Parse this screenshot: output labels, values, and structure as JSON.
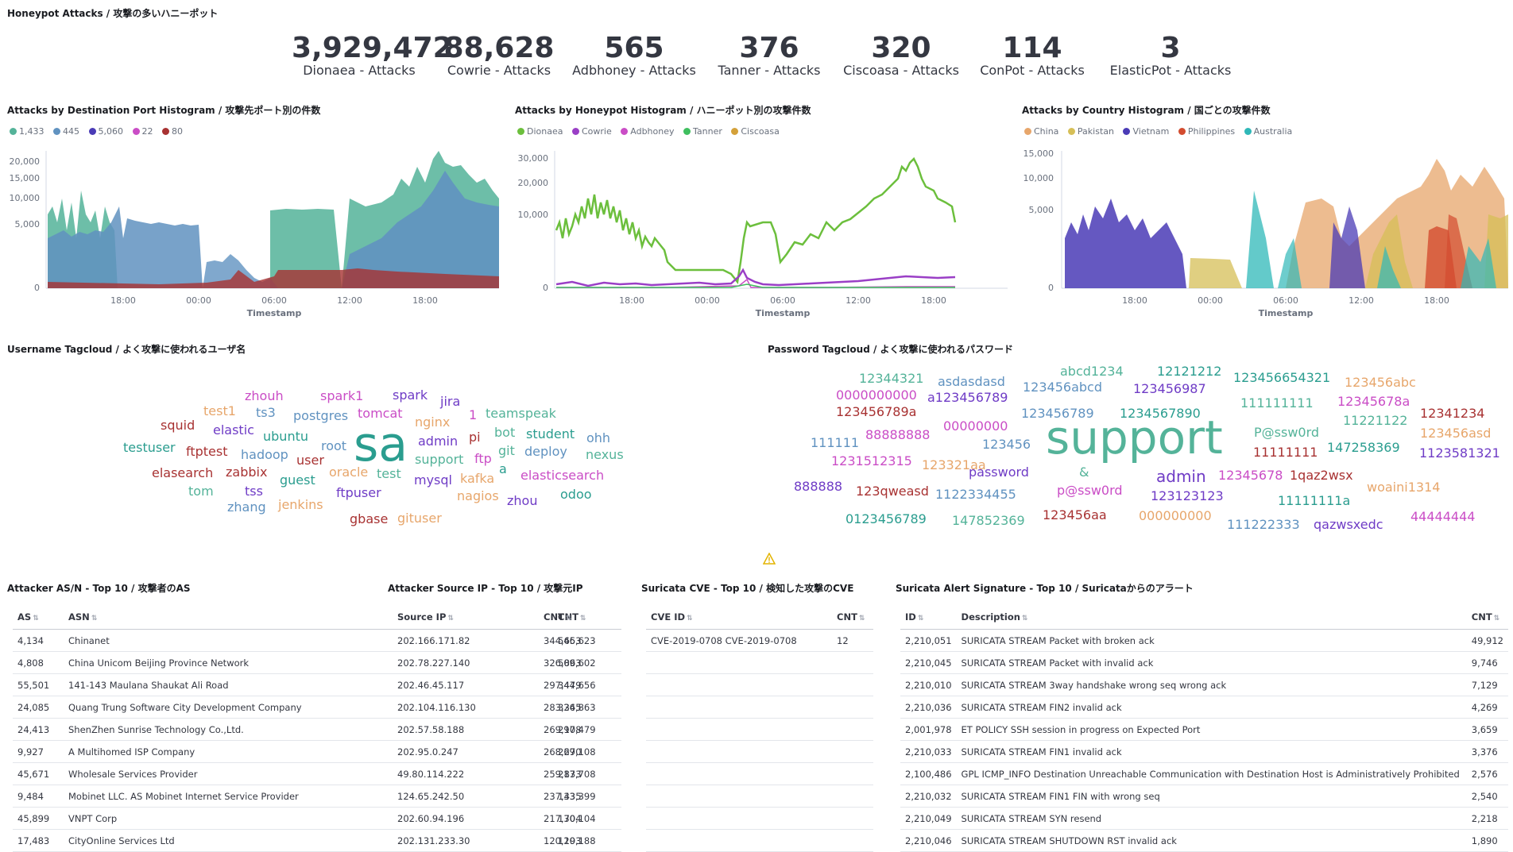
{
  "dashboard": {
    "title": "Honeypot Attacks / 攻撃の多いハニーポット"
  },
  "metrics": [
    {
      "value": "3,929,472",
      "label": "Dionaea - Attacks"
    },
    {
      "value": "88,628",
      "label": "Cowrie - Attacks"
    },
    {
      "value": "565",
      "label": "Adbhoney - Attacks"
    },
    {
      "value": "376",
      "label": "Tanner - Attacks"
    },
    {
      "value": "320",
      "label": "Ciscoasa - Attacks"
    },
    {
      "value": "114",
      "label": "ConPot - Attacks"
    },
    {
      "value": "3",
      "label": "ElasticPot - Attacks"
    }
  ],
  "charts": {
    "port": {
      "title": "Attacks by Destination Port Histogram / 攻撃先ポート別の件数",
      "legend": [
        {
          "name": "1,433",
          "color": "#54b399"
        },
        {
          "name": "445",
          "color": "#6092c0"
        },
        {
          "name": "5,060",
          "color": "#4a3bb6"
        },
        {
          "name": "22",
          "color": "#ca4dc6"
        },
        {
          "name": "80",
          "color": "#a83232"
        }
      ],
      "yticks": [
        "20,000",
        "15,000",
        "10,000",
        "5,000",
        "0"
      ],
      "xticks": [
        "18:00",
        "00:00",
        "06:00",
        "12:00",
        "18:00"
      ],
      "xlabel": "Timestamp"
    },
    "honeypot": {
      "title": "Attacks by Honeypot Histogram / ハニーポット別の攻撃件数",
      "legend": [
        {
          "name": "Dionaea",
          "color": "#6cbf3d"
        },
        {
          "name": "Cowrie",
          "color": "#9a3fc6"
        },
        {
          "name": "Adbhoney",
          "color": "#ca4dc6"
        },
        {
          "name": "Tanner",
          "color": "#3fbf5f"
        },
        {
          "name": "Ciscoasa",
          "color": "#d4a13a"
        }
      ],
      "yticks": [
        "30,000",
        "20,000",
        "10,000",
        "0"
      ],
      "xticks": [
        "18:00",
        "00:00",
        "06:00",
        "12:00",
        "18:00"
      ],
      "xlabel": "Timestamp"
    },
    "country": {
      "title": "Attacks by Country Histogram / 国ごとの攻撃件数",
      "legend": [
        {
          "name": "China",
          "color": "#e7a66b"
        },
        {
          "name": "Pakistan",
          "color": "#d6bf57"
        },
        {
          "name": "Vietnam",
          "color": "#4a3bb6"
        },
        {
          "name": "Philippines",
          "color": "#d34c2f"
        },
        {
          "name": "Australia",
          "color": "#2fb8b8"
        }
      ],
      "yticks": [
        "15,000",
        "10,000",
        "5,000",
        "0"
      ],
      "xticks": [
        "18:00",
        "00:00",
        "06:00",
        "12:00",
        "18:00"
      ],
      "xlabel": "Timestamp"
    }
  },
  "username_cloud": {
    "title": "Username Tagcloud / よく攻撃に使われるユーザ名",
    "tags": [
      {
        "text": "sa",
        "color": "#2a9d8f"
      },
      {
        "text": "zhouh",
        "color": "#ca4dc6"
      },
      {
        "text": "spark1",
        "color": "#ca4dc6"
      },
      {
        "text": "spark",
        "color": "#6f3cc6"
      },
      {
        "text": "test1",
        "color": "#e7a66b"
      },
      {
        "text": "ts3",
        "color": "#6092c0"
      },
      {
        "text": "postgres",
        "color": "#6092c0"
      },
      {
        "text": "tomcat",
        "color": "#ca4dc6"
      },
      {
        "text": "jira",
        "color": "#6f3cc6"
      },
      {
        "text": "teamspeak",
        "color": "#54b399"
      },
      {
        "text": "squid",
        "color": "#a83232"
      },
      {
        "text": "elastic",
        "color": "#6f3cc6"
      },
      {
        "text": "nginx",
        "color": "#e7a66b"
      },
      {
        "text": "1",
        "color": "#ca4dc6"
      },
      {
        "text": "bot",
        "color": "#54b399"
      },
      {
        "text": "student",
        "color": "#2a9d8f"
      },
      {
        "text": "ubuntu",
        "color": "#2a9d8f"
      },
      {
        "text": "admin",
        "color": "#6f3cc6"
      },
      {
        "text": "pi",
        "color": "#a83232"
      },
      {
        "text": "ohh",
        "color": "#6092c0"
      },
      {
        "text": "testuser",
        "color": "#2a9d8f"
      },
      {
        "text": "ftptest",
        "color": "#a83232"
      },
      {
        "text": "hadoop",
        "color": "#6092c0"
      },
      {
        "text": "root",
        "color": "#6092c0"
      },
      {
        "text": "git",
        "color": "#54b399"
      },
      {
        "text": "deploy",
        "color": "#6092c0"
      },
      {
        "text": "nexus",
        "color": "#54b399"
      },
      {
        "text": "user",
        "color": "#a83232"
      },
      {
        "text": "support",
        "color": "#54b399"
      },
      {
        "text": "ftp",
        "color": "#ca4dc6"
      },
      {
        "text": "elasearch",
        "color": "#a83232"
      },
      {
        "text": "zabbix",
        "color": "#a83232"
      },
      {
        "text": "oracle",
        "color": "#e7a66b"
      },
      {
        "text": "test",
        "color": "#54b399"
      },
      {
        "text": "a",
        "color": "#2a9d8f"
      },
      {
        "text": "elasticsearch",
        "color": "#ca4dc6"
      },
      {
        "text": "guest",
        "color": "#2a9d8f"
      },
      {
        "text": "mysql",
        "color": "#6f3cc6"
      },
      {
        "text": "kafka",
        "color": "#e7a66b"
      },
      {
        "text": "tom",
        "color": "#54b399"
      },
      {
        "text": "tss",
        "color": "#6f3cc6"
      },
      {
        "text": "ftpuser",
        "color": "#6f3cc6"
      },
      {
        "text": "nagios",
        "color": "#e7a66b"
      },
      {
        "text": "odoo",
        "color": "#2a9d8f"
      },
      {
        "text": "zhang",
        "color": "#6092c0"
      },
      {
        "text": "jenkins",
        "color": "#e7a66b"
      },
      {
        "text": "zhou",
        "color": "#6f3cc6"
      },
      {
        "text": "gbase",
        "color": "#a83232"
      },
      {
        "text": "gituser",
        "color": "#e7a66b"
      }
    ]
  },
  "password_cloud": {
    "title": "Password Tagcloud / よく攻撃に使われるパスワード",
    "tags": [
      {
        "text": "support",
        "color": "#54b399"
      },
      {
        "text": "abcd1234",
        "color": "#54b399"
      },
      {
        "text": "12121212",
        "color": "#2a9d8f"
      },
      {
        "text": "12344321",
        "color": "#54b399"
      },
      {
        "text": "asdasdasd",
        "color": "#6092c0"
      },
      {
        "text": "123456654321",
        "color": "#2a9d8f"
      },
      {
        "text": "123456abc",
        "color": "#e7a66b"
      },
      {
        "text": "0000000000",
        "color": "#ca4dc6"
      },
      {
        "text": "a123456789",
        "color": "#6f3cc6"
      },
      {
        "text": "123456abcd",
        "color": "#6092c0"
      },
      {
        "text": "123456987",
        "color": "#6f3cc6"
      },
      {
        "text": "111111111",
        "color": "#54b399"
      },
      {
        "text": "12345678a",
        "color": "#ca4dc6"
      },
      {
        "text": "123456789a",
        "color": "#a83232"
      },
      {
        "text": "123456789",
        "color": "#6092c0"
      },
      {
        "text": "1234567890",
        "color": "#2a9d8f"
      },
      {
        "text": "11221122",
        "color": "#54b399"
      },
      {
        "text": "12341234",
        "color": "#a83232"
      },
      {
        "text": "88888888",
        "color": "#ca4dc6"
      },
      {
        "text": "00000000",
        "color": "#ca4dc6"
      },
      {
        "text": "P@ssw0rd",
        "color": "#54b399"
      },
      {
        "text": "123456asd",
        "color": "#e7a66b"
      },
      {
        "text": "111111",
        "color": "#6092c0"
      },
      {
        "text": "123456",
        "color": "#6092c0"
      },
      {
        "text": "147258369",
        "color": "#2a9d8f"
      },
      {
        "text": "11111111",
        "color": "#a83232"
      },
      {
        "text": "1231512315",
        "color": "#ca4dc6"
      },
      {
        "text": "123321aa",
        "color": "#e7a66b"
      },
      {
        "text": "1123581321",
        "color": "#6f3cc6"
      },
      {
        "text": "password",
        "color": "#6f3cc6"
      },
      {
        "text": "&",
        "color": "#54b399"
      },
      {
        "text": "admin",
        "color": "#6f3cc6"
      },
      {
        "text": "12345678",
        "color": "#ca4dc6"
      },
      {
        "text": "1qaz2wsx",
        "color": "#a83232"
      },
      {
        "text": "888888",
        "color": "#6f3cc6"
      },
      {
        "text": "123qweasd",
        "color": "#a83232"
      },
      {
        "text": "1122334455",
        "color": "#6092c0"
      },
      {
        "text": "p@ssw0rd",
        "color": "#ca4dc6"
      },
      {
        "text": "123123123",
        "color": "#6f3cc6"
      },
      {
        "text": "woaini1314",
        "color": "#e7a66b"
      },
      {
        "text": "11111111a",
        "color": "#2a9d8f"
      },
      {
        "text": "0123456789",
        "color": "#2a9d8f"
      },
      {
        "text": "147852369",
        "color": "#54b399"
      },
      {
        "text": "123456aa",
        "color": "#a83232"
      },
      {
        "text": "000000000",
        "color": "#e7a66b"
      },
      {
        "text": "111222333",
        "color": "#6092c0"
      },
      {
        "text": "qazwsxedc",
        "color": "#6f3cc6"
      },
      {
        "text": "44444444",
        "color": "#ca4dc6"
      }
    ]
  },
  "tables": {
    "asn": {
      "title": "Attacker AS/N - Top 10 / 攻撃者のAS",
      "headers": [
        "AS",
        "ASN",
        "CNT"
      ],
      "rows": [
        [
          "4,134",
          "Chinanet",
          "546,623"
        ],
        [
          "4,808",
          "China Unicom Beijing Province Network",
          "509,602"
        ],
        [
          "55,501",
          "141-143 Maulana Shaukat Ali Road",
          "344,656"
        ],
        [
          "24,085",
          "Quang Trung Software City Development Company",
          "326,863"
        ],
        [
          "24,413",
          "ShenZhen Sunrise Technology Co.,Ltd.",
          "297,479"
        ],
        [
          "9,927",
          "A Multihomed ISP Company",
          "269,108"
        ],
        [
          "45,671",
          "Wholesale Services Provider",
          "217,708"
        ],
        [
          "9,484",
          "Mobinet LLC. AS Mobinet Internet Service Provider",
          "133,399"
        ],
        [
          "45,899",
          "VNPT Corp",
          "130,104"
        ],
        [
          "17,483",
          "CityOnline Services Ltd",
          "120,188"
        ]
      ]
    },
    "srcip": {
      "title": "Attacker Source IP - Top 10 / 攻撃元IP",
      "headers": [
        "Source IP",
        "CNT"
      ],
      "rows": [
        [
          "202.166.171.82",
          "344,653"
        ],
        [
          "202.78.227.140",
          "326,863"
        ],
        [
          "202.46.45.117",
          "297,479"
        ],
        [
          "202.104.116.130",
          "283,345"
        ],
        [
          "202.57.58.188",
          "269,108"
        ],
        [
          "202.95.0.247",
          "268,270"
        ],
        [
          "49.80.114.222",
          "259,833"
        ],
        [
          "124.65.242.50",
          "237,435"
        ],
        [
          "202.60.94.196",
          "217,704"
        ],
        [
          "202.131.233.30",
          "120,193"
        ]
      ]
    },
    "cve": {
      "title": "Suricata CVE - Top 10 / 検知した攻撃のCVE",
      "headers": [
        "CVE ID",
        "CNT"
      ],
      "rows": [
        [
          "CVE-2019-0708 CVE-2019-0708",
          "12"
        ]
      ]
    },
    "alert": {
      "title": "Suricata Alert Signature - Top 10 / Suricataからのアラート",
      "headers": [
        "ID",
        "Description",
        "CNT"
      ],
      "rows": [
        [
          "2,210,051",
          "SURICATA STREAM Packet with broken ack",
          "49,912"
        ],
        [
          "2,210,045",
          "SURICATA STREAM Packet with invalid ack",
          "9,746"
        ],
        [
          "2,210,010",
          "SURICATA STREAM 3way handshake wrong seq wrong ack",
          "7,129"
        ],
        [
          "2,210,036",
          "SURICATA STREAM FIN2 invalid ack",
          "4,269"
        ],
        [
          "2,001,978",
          "ET POLICY SSH session in progress on Expected Port",
          "3,659"
        ],
        [
          "2,210,033",
          "SURICATA STREAM FIN1 invalid ack",
          "3,376"
        ],
        [
          "2,100,486",
          "GPL ICMP_INFO Destination Unreachable Communication with Destination Host is Administratively Prohibited",
          "2,576"
        ],
        [
          "2,210,032",
          "SURICATA STREAM FIN1 FIN with wrong seq",
          "2,540"
        ],
        [
          "2,210,049",
          "SURICATA STREAM SYN resend",
          "2,218"
        ],
        [
          "2,210,046",
          "SURICATA STREAM SHUTDOWN RST invalid ack",
          "1,890"
        ]
      ]
    }
  }
}
